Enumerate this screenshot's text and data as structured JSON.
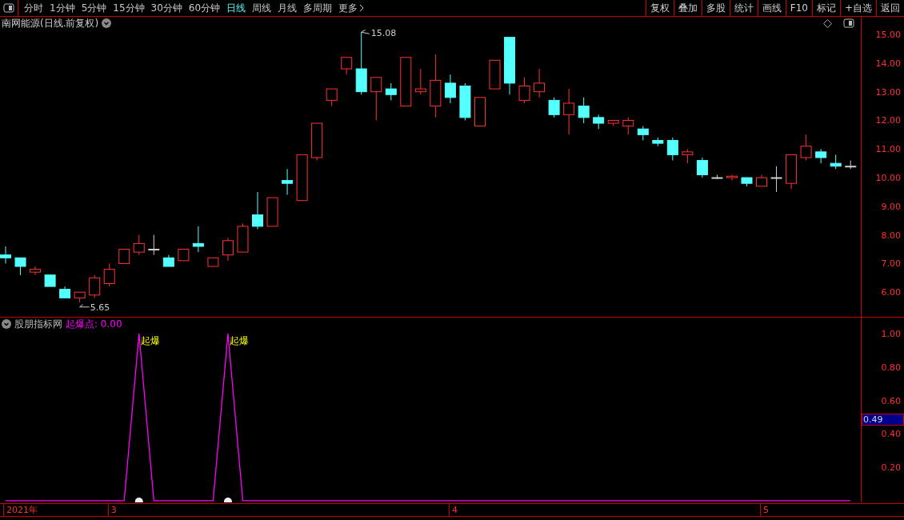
{
  "toolbar": {
    "periods": [
      {
        "label": "分时",
        "selected": false
      },
      {
        "label": "1分钟",
        "selected": false
      },
      {
        "label": "5分钟",
        "selected": false
      },
      {
        "label": "15分钟",
        "selected": false
      },
      {
        "label": "30分钟",
        "selected": false
      },
      {
        "label": "60分钟",
        "selected": false
      },
      {
        "label": "日线",
        "selected": true
      },
      {
        "label": "周线",
        "selected": false
      },
      {
        "label": "月线",
        "selected": false
      },
      {
        "label": "多周期",
        "selected": false
      },
      {
        "label": "更多",
        "selected": false
      }
    ],
    "buttons": [
      "复权",
      "叠加",
      "多股",
      "统计",
      "画线",
      "F10",
      "标记",
      "+自选",
      "返回"
    ]
  },
  "price_chart": {
    "title": "南网能源(日线.前复权)",
    "chart_data": {
      "type": "candlestick",
      "ylim": [
        5.14,
        15.17
      ],
      "ohlc": [
        [
          7.3,
          7.6,
          7.0,
          7.2
        ],
        [
          7.2,
          7.2,
          6.6,
          6.9
        ],
        [
          6.7,
          6.9,
          6.6,
          6.8
        ],
        [
          6.6,
          6.6,
          6.2,
          6.2
        ],
        [
          6.1,
          6.2,
          5.8,
          5.8
        ],
        [
          5.8,
          6.0,
          5.65,
          6.0
        ],
        [
          5.9,
          6.6,
          5.8,
          6.5
        ],
        [
          6.3,
          7.0,
          6.2,
          6.8
        ],
        [
          7.0,
          7.5,
          7.0,
          7.5
        ],
        [
          7.4,
          8.0,
          7.3,
          7.7
        ],
        [
          7.5,
          8.0,
          7.3,
          7.5
        ],
        [
          7.2,
          7.3,
          6.9,
          6.9
        ],
        [
          7.1,
          7.5,
          7.1,
          7.5
        ],
        [
          7.7,
          8.3,
          7.4,
          7.6
        ],
        [
          6.9,
          7.2,
          6.9,
          7.2
        ],
        [
          7.3,
          7.9,
          7.1,
          7.8
        ],
        [
          7.4,
          8.4,
          7.4,
          8.3
        ],
        [
          8.7,
          9.5,
          8.2,
          8.3
        ],
        [
          8.3,
          9.3,
          8.3,
          9.3
        ],
        [
          9.9,
          10.3,
          9.4,
          9.8
        ],
        [
          9.2,
          10.8,
          9.2,
          10.8
        ],
        [
          10.7,
          11.9,
          10.6,
          11.9
        ],
        [
          12.7,
          13.1,
          12.5,
          13.1
        ],
        [
          13.8,
          14.2,
          13.6,
          14.2
        ],
        [
          13.8,
          15.08,
          12.9,
          13.0
        ],
        [
          13.0,
          13.5,
          12.0,
          13.5
        ],
        [
          13.1,
          13.3,
          12.7,
          12.9
        ],
        [
          12.5,
          14.2,
          12.5,
          14.2
        ],
        [
          13.0,
          13.8,
          12.9,
          13.1
        ],
        [
          12.5,
          14.3,
          12.1,
          13.4
        ],
        [
          13.3,
          13.6,
          12.6,
          12.8
        ],
        [
          13.2,
          13.3,
          12.0,
          12.1
        ],
        [
          11.8,
          12.8,
          11.8,
          12.8
        ],
        [
          13.1,
          14.1,
          13.1,
          14.1
        ],
        [
          14.9,
          14.9,
          12.9,
          13.3
        ],
        [
          12.7,
          13.5,
          12.6,
          13.2
        ],
        [
          13.0,
          13.8,
          12.8,
          13.3
        ],
        [
          12.7,
          12.8,
          12.1,
          12.2
        ],
        [
          12.2,
          13.1,
          11.5,
          12.6
        ],
        [
          12.5,
          12.8,
          11.9,
          12.1
        ],
        [
          12.1,
          12.2,
          11.7,
          11.9
        ],
        [
          11.9,
          12.0,
          11.8,
          12.0
        ],
        [
          11.8,
          12.1,
          11.5,
          12.0
        ],
        [
          11.7,
          11.8,
          11.3,
          11.5
        ],
        [
          11.3,
          11.4,
          11.1,
          11.2
        ],
        [
          11.3,
          11.4,
          10.6,
          10.8
        ],
        [
          10.8,
          11.0,
          10.5,
          10.9
        ],
        [
          10.6,
          10.7,
          10.0,
          10.1
        ],
        [
          10.0,
          10.1,
          9.95,
          10.0
        ],
        [
          10.0,
          10.1,
          9.9,
          10.05
        ],
        [
          10.0,
          10.0,
          9.7,
          9.8
        ],
        [
          9.7,
          10.1,
          9.7,
          10.0
        ],
        [
          10.0,
          10.4,
          9.5,
          10.0
        ],
        [
          9.8,
          10.8,
          9.6,
          10.8
        ],
        [
          10.7,
          11.5,
          10.6,
          11.1
        ],
        [
          10.9,
          11.0,
          10.5,
          10.7
        ],
        [
          10.5,
          10.8,
          10.3,
          10.4
        ],
        [
          10.4,
          10.6,
          10.3,
          10.4
        ]
      ],
      "yticks": [
        {
          "value": 15,
          "label": "15.00"
        },
        {
          "value": 14,
          "label": "14.00"
        },
        {
          "value": 13,
          "label": "13.00"
        },
        {
          "value": 12,
          "label": "12.00"
        },
        {
          "value": 11,
          "label": "11.00"
        },
        {
          "value": 10,
          "label": "10.00"
        },
        {
          "value": 9,
          "label": "9.00"
        },
        {
          "value": 8,
          "label": "8.00"
        },
        {
          "value": 7,
          "label": "7.00"
        },
        {
          "value": 6,
          "label": "6.00"
        }
      ],
      "annotations": [
        "15.08",
        "5.65"
      ]
    }
  },
  "indicator": {
    "source": "股朋指标网",
    "reading": ": 0.00",
    "cursor_value": "0.49",
    "chart_data": {
      "type": "line",
      "ylim": [
        -0.01,
        1.02
      ],
      "yticks": [
        {
          "value": 1,
          "label": "1.00"
        },
        {
          "value": 0.8,
          "label": "0.80"
        },
        {
          "value": 0.6,
          "label": "0.60"
        },
        {
          "value": 0.4,
          "label": "0.40"
        },
        {
          "value": 0.2,
          "label": "0.20"
        }
      ],
      "series": [
        {
          "name": "起爆点",
          "color": "#ff00ff",
          "values": [
            0,
            0,
            0,
            0,
            0,
            0,
            0,
            0,
            0,
            1,
            0,
            0,
            0,
            0,
            0,
            1,
            0,
            0,
            0,
            0,
            0,
            0,
            0,
            0,
            0,
            0,
            0,
            0,
            0,
            0,
            0,
            0,
            0,
            0,
            0,
            0,
            0,
            0,
            0,
            0,
            0,
            0,
            0,
            0,
            0,
            0,
            0,
            0,
            0,
            0,
            0,
            0,
            0,
            0,
            0,
            0,
            0,
            0
          ]
        }
      ],
      "annotations": [
        "起爆",
        "起爆"
      ]
    }
  },
  "date_axis": [
    "2021年",
    "3",
    "4",
    "5"
  ]
}
